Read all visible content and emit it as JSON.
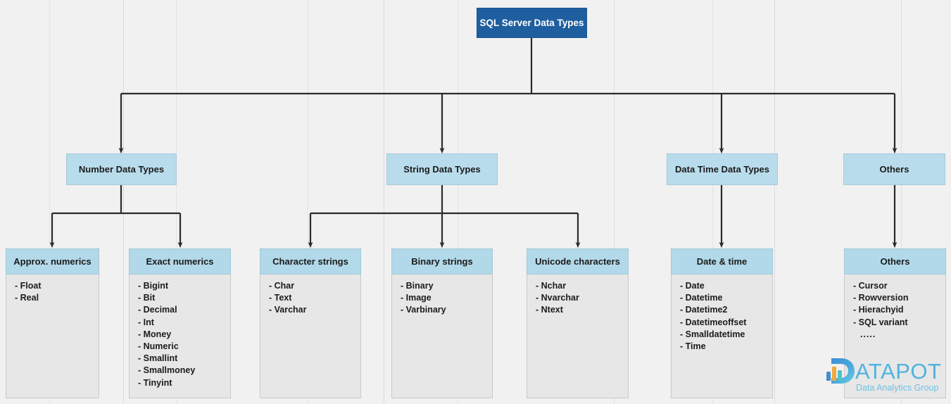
{
  "diagram": {
    "title": "SQL Server Data Types",
    "type": "hierarchy-tree",
    "root": {
      "label": "SQL Server Data Types"
    },
    "level2": [
      {
        "label": "Number Data Types"
      },
      {
        "label": "String Data Types"
      },
      {
        "label": "Data Time Data Types"
      },
      {
        "label": "Others"
      }
    ],
    "leaves": [
      {
        "header": "Approx. numerics",
        "items": [
          "- Float",
          "- Real"
        ]
      },
      {
        "header": "Exact numerics",
        "items": [
          "- Bigint",
          "- Bit",
          "- Decimal",
          "- Int",
          "- Money",
          "- Numeric",
          "- Smallint",
          "- Smallmoney",
          "- Tinyint"
        ]
      },
      {
        "header": "Character strings",
        "items": [
          "- Char",
          "- Text",
          "- Varchar"
        ]
      },
      {
        "header": "Binary strings",
        "items": [
          "- Binary",
          "- Image",
          "- Varbinary"
        ]
      },
      {
        "header": "Unicode characters",
        "items": [
          "- Nchar",
          "- Nvarchar",
          "- Ntext"
        ]
      },
      {
        "header": "Date & time",
        "items": [
          "- Date",
          "- Datetime",
          "- Datetime2",
          "- Datetimeoffset",
          "- Smalldatetime",
          "- Time"
        ]
      },
      {
        "header": "Others",
        "items": [
          "- Cursor",
          "- Rowversion",
          "- Hierachyid",
          "- SQL variant",
          "....."
        ]
      }
    ]
  },
  "logo": {
    "letter": "D",
    "word": "ATAPOT",
    "tagline": "Data Analytics Group"
  },
  "colors": {
    "root_fill": "#1f5fa0",
    "root_text": "#ffffff",
    "level2_fill": "#b9dcec",
    "leaf_header_fill": "#b2d9e9",
    "leaf_body_fill": "#e7e7e7",
    "connector": "#2b2b2b",
    "background": "#f1f1f1",
    "logo_blue": "#4fb3e0"
  }
}
